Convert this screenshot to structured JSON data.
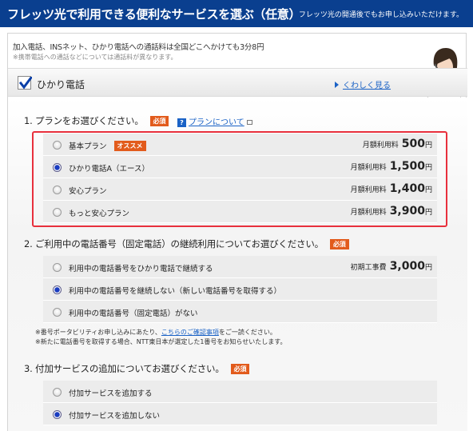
{
  "header": {
    "title": "フレッツ光で利用できる便利なサービスを選ぶ（任意）",
    "subtitle": "フレッツ光の開通後でもお申し込みいただけます。"
  },
  "service": {
    "desc_line1": "加入電話、INSネット、ひかり電話への通話料は全国どこへかけても3分8円",
    "desc_line2": "※携帯電話への通話などについては通話料が異なります。",
    "name": "ひかり電話",
    "checked": true,
    "more_link": "くわしく見る"
  },
  "q1": {
    "label": "1. プランをお選びください。",
    "required": "必須",
    "help_link": "プランについて",
    "help_icon": "?",
    "options": [
      {
        "label": "基本プラン",
        "badge": "オススメ",
        "price_label": "月額利用料",
        "price": "500",
        "unit": "円",
        "selected": false
      },
      {
        "label": "ひかり電話A（エース）",
        "badge": "",
        "price_label": "月額利用料",
        "price": "1,500",
        "unit": "円",
        "selected": true
      },
      {
        "label": "安心プラン",
        "badge": "",
        "price_label": "月額利用料",
        "price": "1,400",
        "unit": "円",
        "selected": false
      },
      {
        "label": "もっと安心プラン",
        "badge": "",
        "price_label": "月額利用料",
        "price": "3,900",
        "unit": "円",
        "selected": false
      }
    ]
  },
  "q2": {
    "label": "2. ご利用中の電話番号（固定電話）の継続利用についてお選びください。",
    "required": "必須",
    "options": [
      {
        "label": "利用中の電話番号をひかり電話で継続する",
        "price_label": "初期工事費",
        "price": "3,000",
        "unit": "円",
        "selected": false
      },
      {
        "label": "利用中の電話番号を継続しない（新しい電話番号を取得する）",
        "selected": true
      },
      {
        "label": "利用中の電話番号（固定電話）がない",
        "selected": false
      }
    ],
    "note1_pre": "※番号ポータビリティお申し込みにあたり、",
    "note1_link": "こちらのご確認事項",
    "note1_post": "をご一読ください。",
    "note2": "※新たに電話番号を取得する場合、NTT東日本が選定した1番号をお知らせいたします。"
  },
  "q3": {
    "label": "3. 付加サービスの追加についてお選びください。",
    "required": "必須",
    "options": [
      {
        "label": "付加サービスを追加する",
        "selected": false
      },
      {
        "label": "付加サービスを追加しない",
        "selected": true
      }
    ]
  }
}
